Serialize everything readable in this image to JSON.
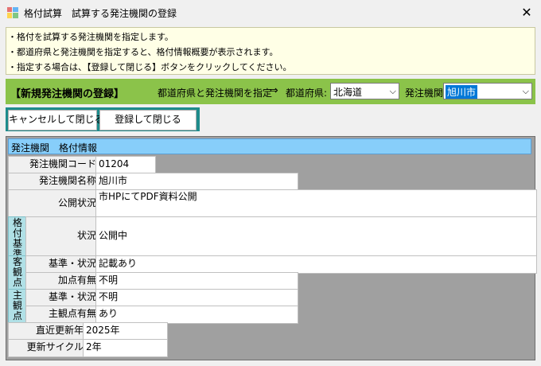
{
  "window": {
    "title": "格付試算　試算する発注機関の登録",
    "icon": "app-grid-icon",
    "close_glyph": "✕"
  },
  "info": {
    "lines": [
      "・格付を試算する発注機関を指定します。",
      "・都道府県と発注機関を指定すると、格付情報概要が表示されます。",
      "・指定する場合は、【登録して閉じる】ボタンをクリックしてください。"
    ]
  },
  "register": {
    "section_title": "【新規発注機関の登録】",
    "instruction": "都道府県と発注機関を指定",
    "arrow": "⇒",
    "prefecture_label": "都道府県:",
    "prefecture_value": "北海道",
    "agency_label": "発注機関:",
    "agency_value": "旭川市",
    "chevron": "⌵"
  },
  "buttons": {
    "cancel": "キャンセルして閉じる",
    "register": "登録して閉じる"
  },
  "grid": {
    "title": "発注機関　格付情報",
    "code_label": "発注機関コード",
    "code_value": "01204",
    "name_label": "発注機関名称",
    "name_value": "旭川市",
    "publish_label": "公開状況",
    "publish_value": "市HPにてPDF資料公開",
    "rating_group": "格付基準",
    "status_label": "状況",
    "status_value": "公開中",
    "objective_group": "客観点",
    "obj_basis_label": "基準・状況",
    "obj_basis_value": "記載あり",
    "obj_bonus_label": "加点有無",
    "obj_bonus_value": "不明",
    "subjective_group": "主観点",
    "subj_basis_label": "基準・状況",
    "subj_basis_value": "不明",
    "subj_exist_label": "主観点有無",
    "subj_exist_value": "あり",
    "recent_year_label": "直近更新年",
    "recent_year_value": "2025年",
    "cycle_label": "更新サイクル",
    "cycle_value": "2年"
  },
  "colors": {
    "info_bg": "#ffffe6",
    "green_bar": "#8bc34a",
    "button_frame": "#1e8c8c",
    "grid_header": "#87cefa",
    "group_cell": "#b0e0e6",
    "grid_bg": "#a0a0a0"
  }
}
